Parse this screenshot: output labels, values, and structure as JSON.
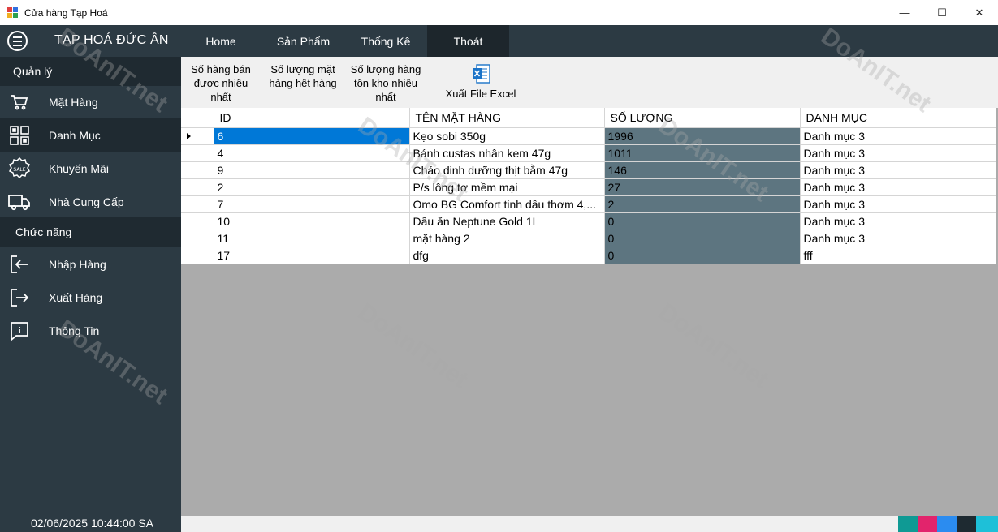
{
  "window": {
    "title": "Cửa hàng Tạp Hoá",
    "minimize": "—",
    "maximize": "☐",
    "close": "✕"
  },
  "navbar": {
    "brand": "TẠP HOÁ ĐỨC ÂN",
    "tabs": [
      {
        "label": "Home"
      },
      {
        "label": "Sản Phẩm"
      },
      {
        "label": "Thống Kê"
      },
      {
        "label": "Thoát",
        "active": true
      }
    ]
  },
  "sidebar": {
    "manage_header": "Quản lý",
    "manage_items": [
      {
        "label": "Mặt Hàng",
        "icon": "cart-icon"
      },
      {
        "label": "Danh Mục",
        "icon": "grid-icon"
      },
      {
        "label": "Khuyến Mãi",
        "icon": "sale-icon"
      },
      {
        "label": "Nhà Cung Cấp",
        "icon": "truck-icon"
      }
    ],
    "function_header": "Chức năng",
    "function_items": [
      {
        "label": "Nhập Hàng",
        "icon": "import-icon"
      },
      {
        "label": "Xuất Hàng",
        "icon": "export-icon"
      },
      {
        "label": "Thông Tin",
        "icon": "info-icon"
      }
    ],
    "datetime": "02/06/2025 10:44:00 SA",
    "sale_badge": "SALE"
  },
  "toolbar": {
    "best_selling": "Số hàng bán được nhiều nhất",
    "out_of_stock": "Số lượng mặt hàng hết hàng",
    "most_in_stock": "Số lượng hàng tồn kho nhiều nhất",
    "export_excel": "Xuất File Excel"
  },
  "grid": {
    "columns": [
      "ID",
      "TÊN MẶT HÀNG",
      "SỐ LƯỢNG",
      "DANH MỤC"
    ],
    "rows": [
      {
        "id": "6",
        "name": "Kẹo sobi 350g",
        "qty": "1996",
        "category": "Danh mục 3"
      },
      {
        "id": "4",
        "name": "Bánh custas nhân kem 47g",
        "qty": "1011",
        "category": "Danh mục 3"
      },
      {
        "id": "9",
        "name": "Cháo dinh dưỡng thịt bằm 47g",
        "qty": "146",
        "category": "Danh mục 3"
      },
      {
        "id": "2",
        "name": "P/s lông tơ mềm mại",
        "qty": "27",
        "category": "Danh mục 3"
      },
      {
        "id": "7",
        "name": "Omo BG Comfort tinh dầu thơm 4,...",
        "qty": "2",
        "category": "Danh mục 3"
      },
      {
        "id": "10",
        "name": "Dầu ăn Neptune Gold 1L",
        "qty": "0",
        "category": "Danh mục 3"
      },
      {
        "id": "11",
        "name": "mặt hàng 2",
        "qty": "0",
        "category": "Danh mục 3"
      },
      {
        "id": "17",
        "name": "dfg",
        "qty": "0",
        "category": "fff"
      }
    ]
  },
  "status_colors": [
    "#0f9a94",
    "#e2246c",
    "#2b8cf0",
    "#1e2a31",
    "#1ec0d8"
  ],
  "watermark": "DoAnIT.net"
}
